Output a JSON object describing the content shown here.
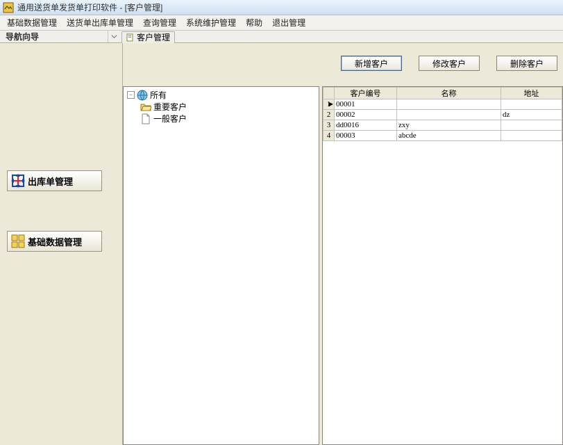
{
  "window": {
    "title": "通用送货单发货单打印软件  - [客户管理]"
  },
  "menu": {
    "m1": "基础数据管理",
    "m2": "送货单出库单管理",
    "m3": "查询管理",
    "m4": "系统维护管理",
    "m5": "帮助",
    "m6": "退出管理"
  },
  "nav": {
    "label": "导航向导",
    "tab": "客户管理"
  },
  "sidebar": {
    "btn1": "出库单管理",
    "btn2": "基础数据管理"
  },
  "actions": {
    "add": "新增客户",
    "edit": "修改客户",
    "del": "删除客户"
  },
  "tree": {
    "root": "所有",
    "n1": "重要客户",
    "n2": "一般客户"
  },
  "grid": {
    "headers": {
      "code": "客户编号",
      "name": "名称",
      "addr": "地址"
    },
    "rows": [
      {
        "n": "1",
        "code": "00001",
        "name": "",
        "addr": ""
      },
      {
        "n": "2",
        "code": "00002",
        "name": "",
        "addr": "dz"
      },
      {
        "n": "3",
        "code": "dd0016",
        "name": "zxy",
        "addr": ""
      },
      {
        "n": "4",
        "code": "00003",
        "name": "abcde",
        "addr": ""
      }
    ]
  }
}
